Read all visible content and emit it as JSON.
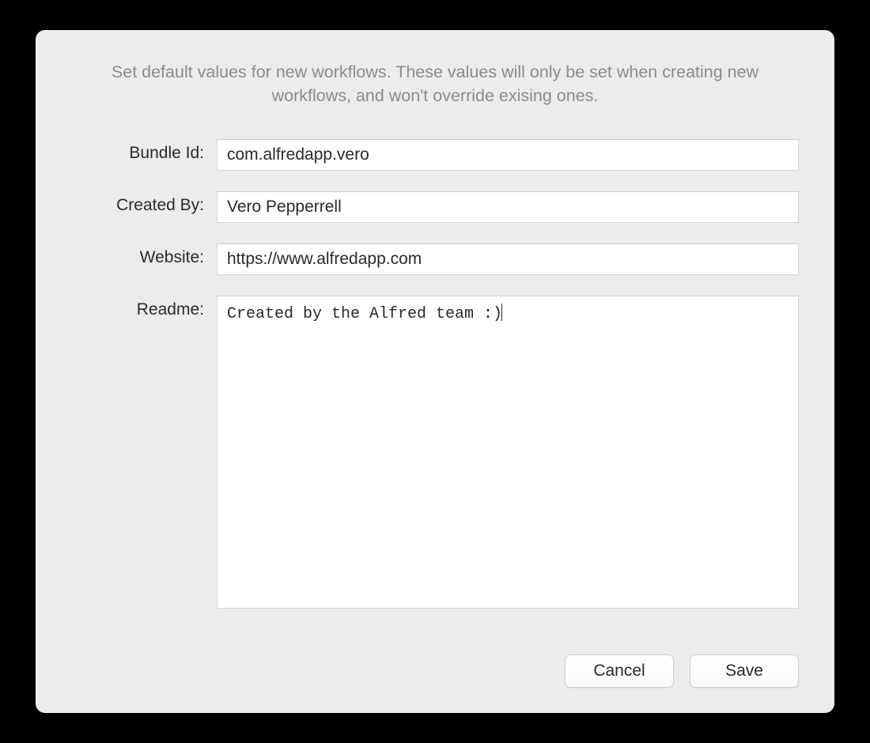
{
  "description": "Set default values for new workflows. These values will only be set when creating new workflows, and won't override exising ones.",
  "fields": {
    "bundle_id": {
      "label": "Bundle Id:",
      "value": "com.alfredapp.vero"
    },
    "created_by": {
      "label": "Created By:",
      "value": "Vero Pepperrell"
    },
    "website": {
      "label": "Website:",
      "value": "https://www.alfredapp.com"
    },
    "readme": {
      "label": "Readme:",
      "value": "Created by the Alfred team :)"
    }
  },
  "buttons": {
    "cancel": "Cancel",
    "save": "Save"
  }
}
